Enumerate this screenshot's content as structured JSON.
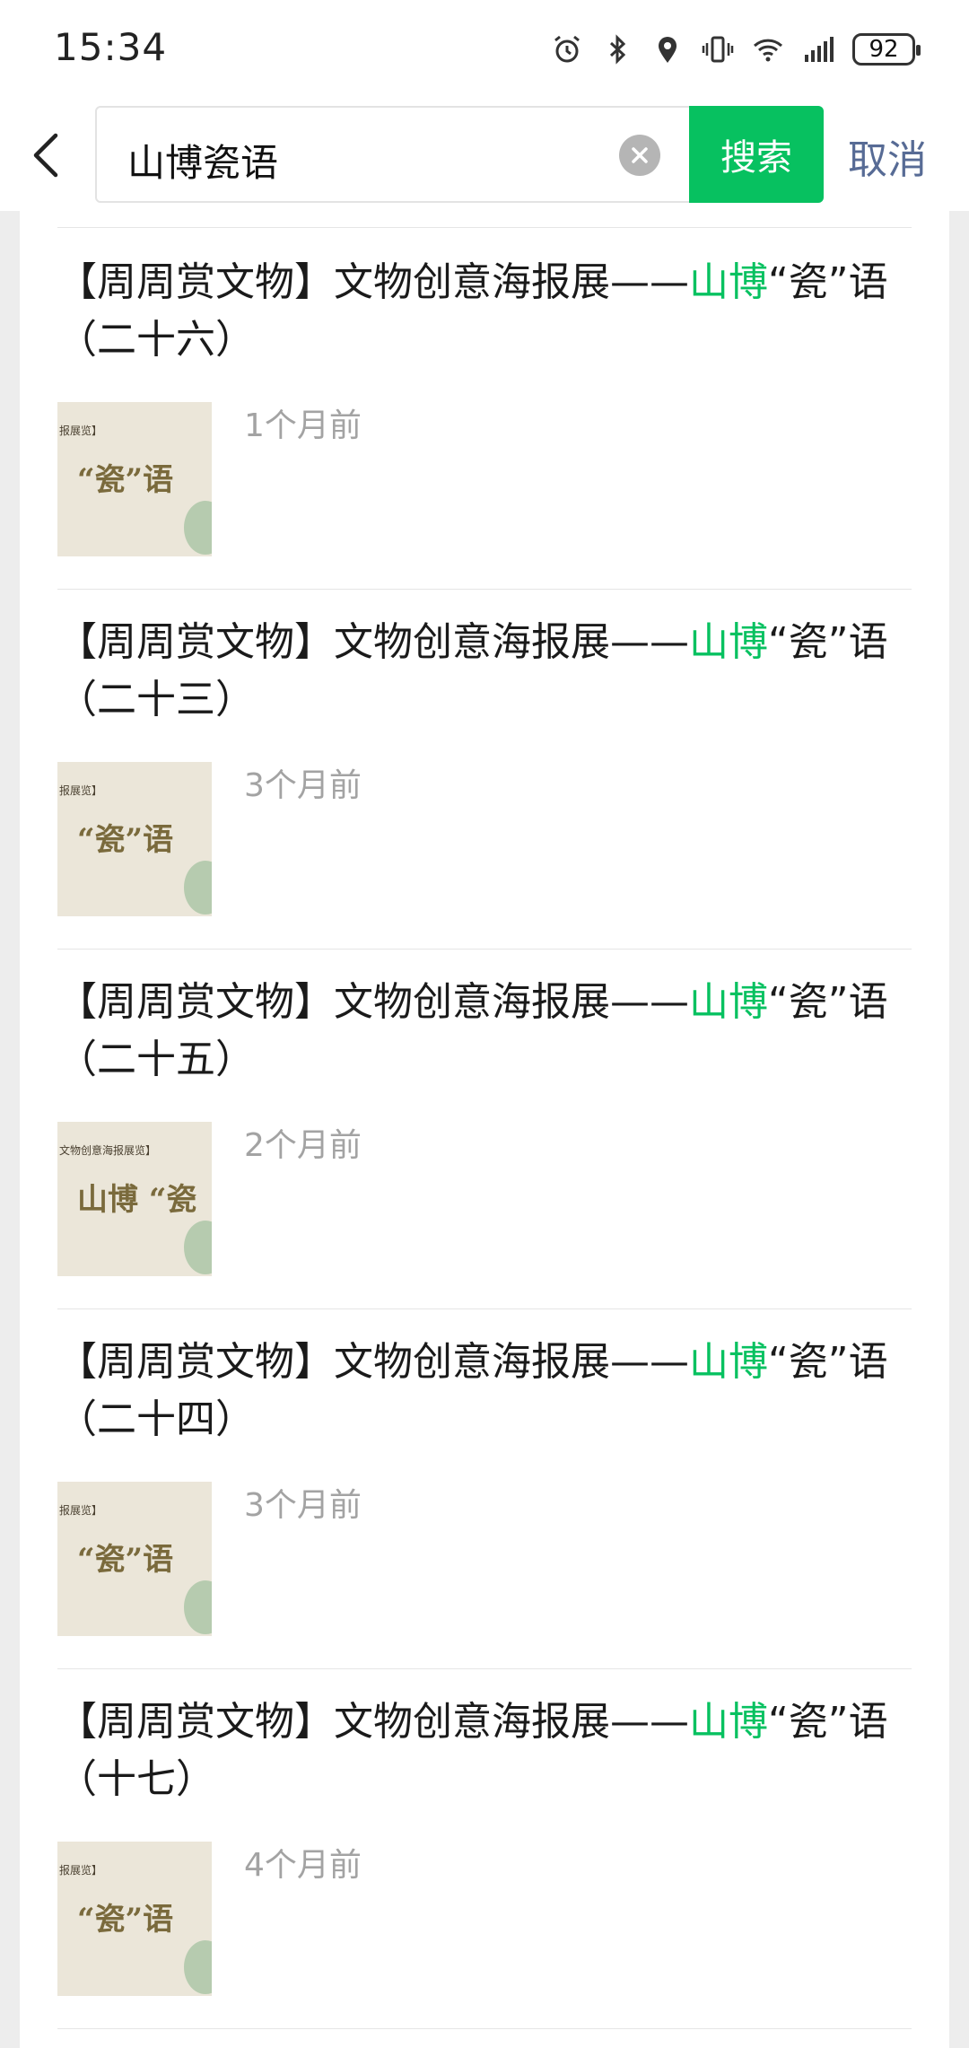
{
  "status": {
    "time": "15:34",
    "battery": "92"
  },
  "search": {
    "query": "山博瓷语",
    "button_label": "搜索",
    "cancel_label": "取消"
  },
  "results": [
    {
      "prefix": "【周周赏文物】文物创意海报展——",
      "highlight": "山博",
      "suffix": "“瓷”语（二十六）",
      "date": "1个月前",
      "thumb_text_top": "报展览】",
      "thumb_text_main": "“瓷”语"
    },
    {
      "prefix": "【周周赏文物】文物创意海报展——",
      "highlight": "山博",
      "suffix": "“瓷”语（二十三）",
      "date": "3个月前",
      "thumb_text_top": "报展览】",
      "thumb_text_main": "“瓷”语"
    },
    {
      "prefix": "【周周赏文物】文物创意海报展——",
      "highlight": "山博",
      "suffix": "“瓷”语（二十五）",
      "date": "2个月前",
      "thumb_text_top": "文物创意海报展览】",
      "thumb_text_main": "山博 “瓷"
    },
    {
      "prefix": "【周周赏文物】文物创意海报展——",
      "highlight": "山博",
      "suffix": "“瓷”语（二十四）",
      "date": "3个月前",
      "thumb_text_top": "报展览】",
      "thumb_text_main": "“瓷”语"
    },
    {
      "prefix": "【周周赏文物】文物创意海报展——",
      "highlight": "山博",
      "suffix": "“瓷”语（十七）",
      "date": "4个月前",
      "thumb_text_top": "报展览】",
      "thumb_text_main": "“瓷”语"
    }
  ],
  "colors": {
    "accent": "#07c160",
    "link": "#576b95"
  }
}
